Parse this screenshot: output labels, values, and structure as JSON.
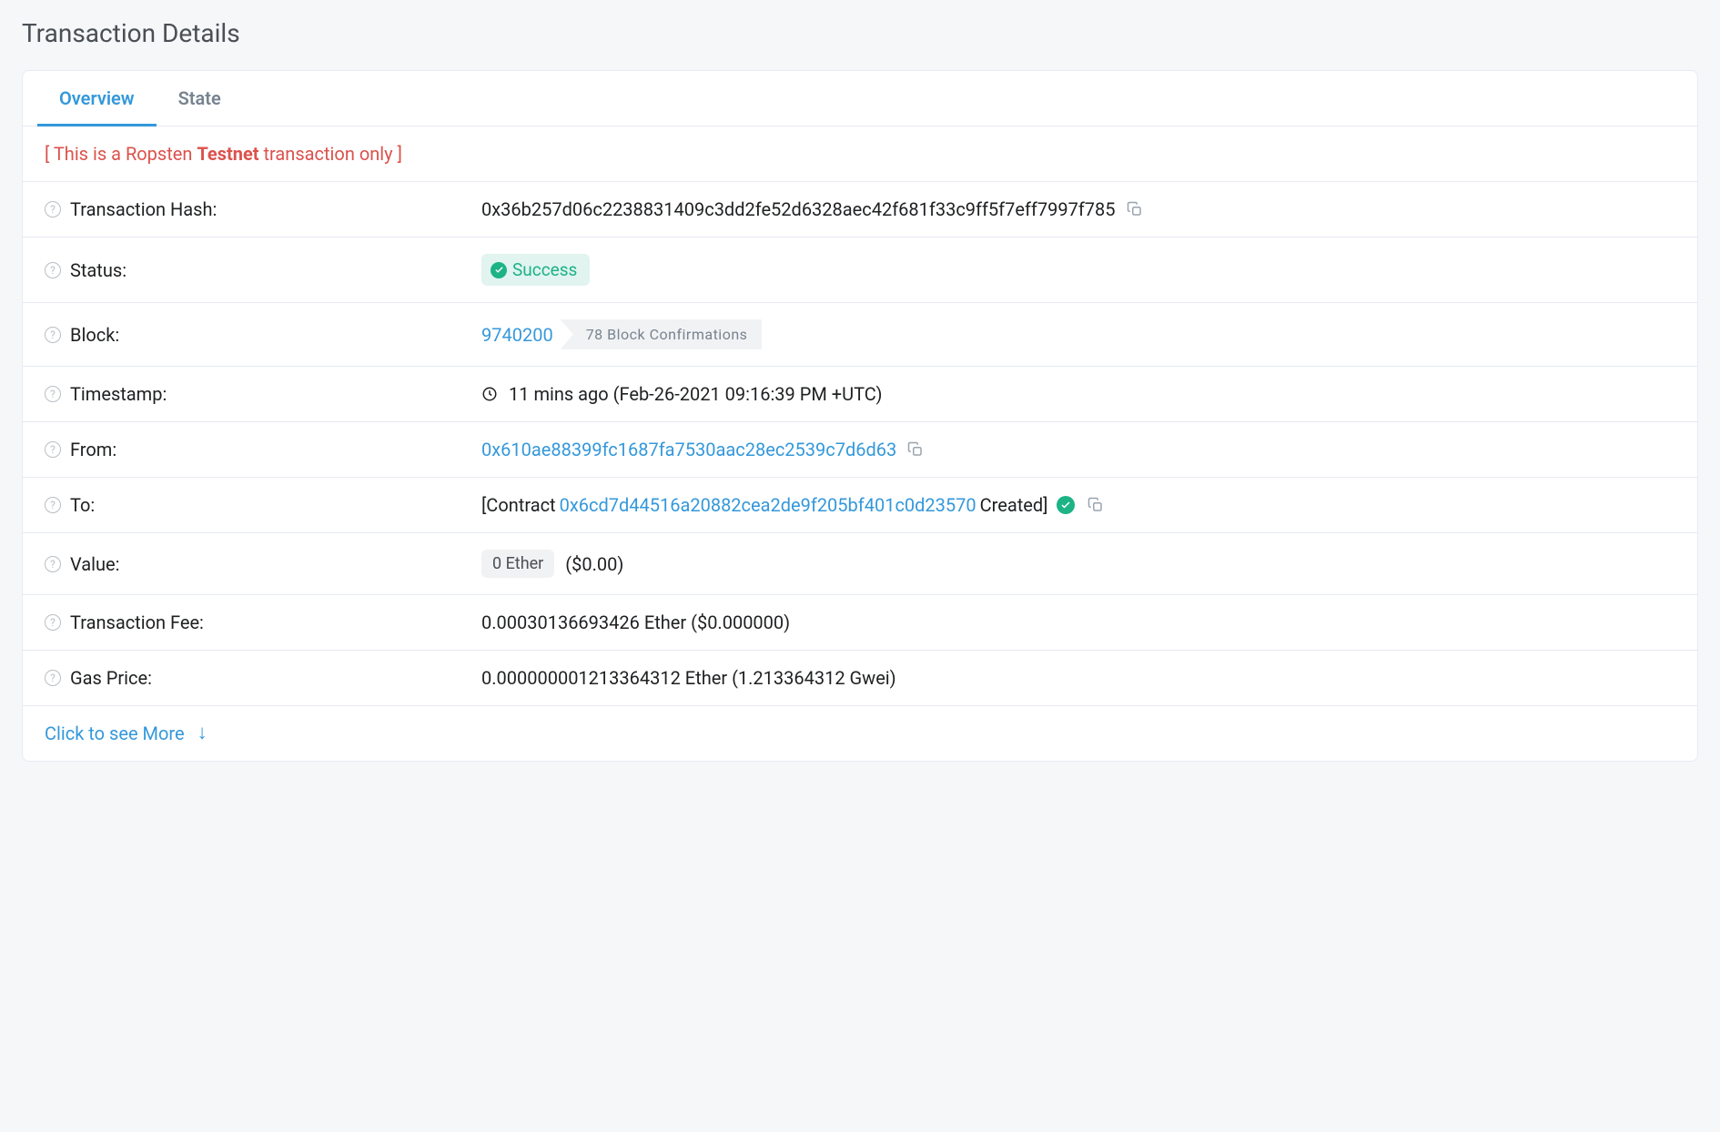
{
  "page_title": "Transaction Details",
  "tabs": {
    "overview": "Overview",
    "state": "State"
  },
  "testnet_notice": {
    "pre": "[ This is a Ropsten ",
    "bold": "Testnet",
    "post": " transaction only ]"
  },
  "labels": {
    "hash": "Transaction Hash:",
    "status": "Status:",
    "block": "Block:",
    "timestamp": "Timestamp:",
    "from": "From:",
    "to": "To:",
    "value": "Value:",
    "fee": "Transaction Fee:",
    "gas": "Gas Price:"
  },
  "values": {
    "hash": "0x36b257d06c2238831409c3dd2fe52d6328aec42f681f33c9ff5f7eff7997f785",
    "status": "Success",
    "block_number": "9740200",
    "block_confirm": "78 Block Confirmations",
    "timestamp": "11 mins ago (Feb-26-2021 09:16:39 PM +UTC)",
    "from": "0x610ae88399fc1687fa7530aac28ec2539c7d6d63",
    "to_prefix": "[Contract ",
    "to_addr": "0x6cd7d44516a20882cea2de9f205bf401c0d23570",
    "to_suffix": " Created]",
    "value_pill": "0 Ether",
    "value_usd": "($0.00)",
    "fee": "0.00030136693426 Ether ($0.000000)",
    "gas": "0.000000001213364312 Ether (1.213364312 Gwei)"
  },
  "see_more": "Click to see More"
}
